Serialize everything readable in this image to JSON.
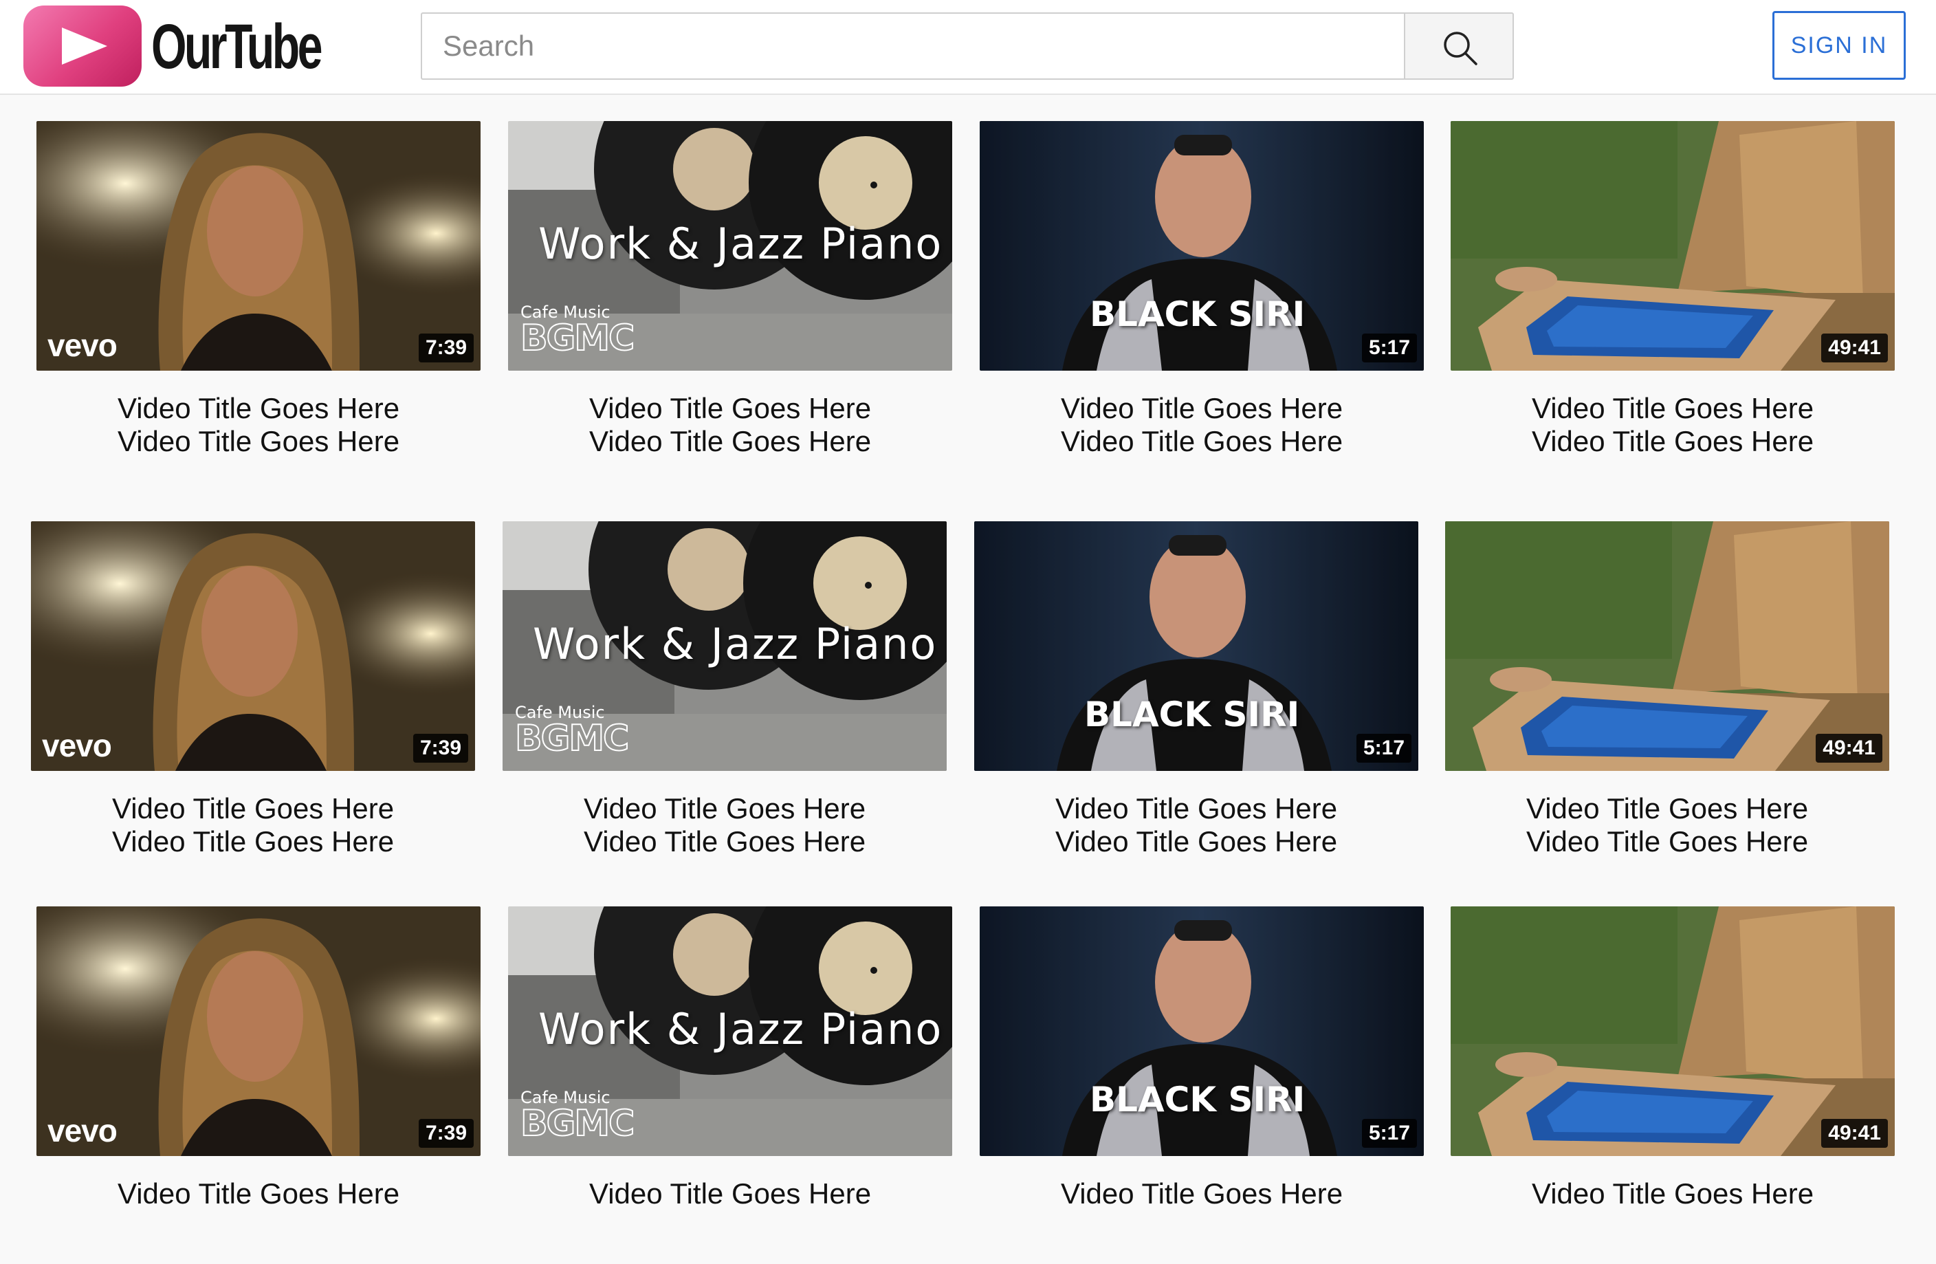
{
  "header": {
    "logo_text": "OurTube",
    "search_placeholder": "Search",
    "signin_label": "SIGN IN"
  },
  "videos": [
    {
      "thumb": "portrait",
      "duration": "7:39",
      "overlay": {
        "brand": "vevo"
      },
      "title_line1": "Video Title Goes Here",
      "title_line2": "Video Title Goes Here"
    },
    {
      "thumb": "vinyl",
      "duration": "",
      "overlay": {
        "title": "Work & Jazz Piano",
        "small": "Cafe Music",
        "logo": "BGMC"
      },
      "title_line1": "Video Title Goes Here",
      "title_line2": "Video Title Goes Here"
    },
    {
      "thumb": "comedian",
      "duration": "5:17",
      "overlay": {
        "caption": "BLACK SIRI"
      },
      "title_line1": "Video Title Goes Here",
      "title_line2": "Video Title Goes Here"
    },
    {
      "thumb": "pool",
      "duration": "49:41",
      "overlay": {},
      "title_line1": "Video Title Goes Here",
      "title_line2": "Video Title Goes Here"
    },
    {
      "thumb": "portrait",
      "duration": "7:39",
      "overlay": {
        "brand": "vevo"
      },
      "title_line1": "Video Title Goes Here",
      "title_line2": "Video Title Goes Here"
    },
    {
      "thumb": "vinyl",
      "duration": "",
      "overlay": {
        "title": "Work & Jazz Piano",
        "small": "Cafe Music",
        "logo": "BGMC"
      },
      "title_line1": "Video Title Goes Here",
      "title_line2": "Video Title Goes Here"
    },
    {
      "thumb": "comedian",
      "duration": "5:17",
      "overlay": {
        "caption": "BLACK SIRI"
      },
      "title_line1": "Video Title Goes Here",
      "title_line2": "Video Title Goes Here"
    },
    {
      "thumb": "pool",
      "duration": "49:41",
      "overlay": {},
      "title_line1": "Video Title Goes Here",
      "title_line2": "Video Title Goes Here"
    },
    {
      "thumb": "portrait",
      "duration": "7:39",
      "overlay": {
        "brand": "vevo"
      },
      "title_line1": "Video Title Goes Here",
      "title_line2": ""
    },
    {
      "thumb": "vinyl",
      "duration": "",
      "overlay": {
        "title": "Work & Jazz Piano",
        "small": "Cafe Music",
        "logo": "BGMC"
      },
      "title_line1": "Video Title Goes Here",
      "title_line2": ""
    },
    {
      "thumb": "comedian",
      "duration": "5:17",
      "overlay": {
        "caption": "BLACK SIRI"
      },
      "title_line1": "Video Title Goes Here",
      "title_line2": ""
    },
    {
      "thumb": "pool",
      "duration": "49:41",
      "overlay": {},
      "title_line1": "Video Title Goes Here",
      "title_line2": ""
    }
  ],
  "colors": {
    "accent": "#2b6fd6",
    "logo_pink": "#e0407f",
    "background": "#f9f9f9"
  }
}
